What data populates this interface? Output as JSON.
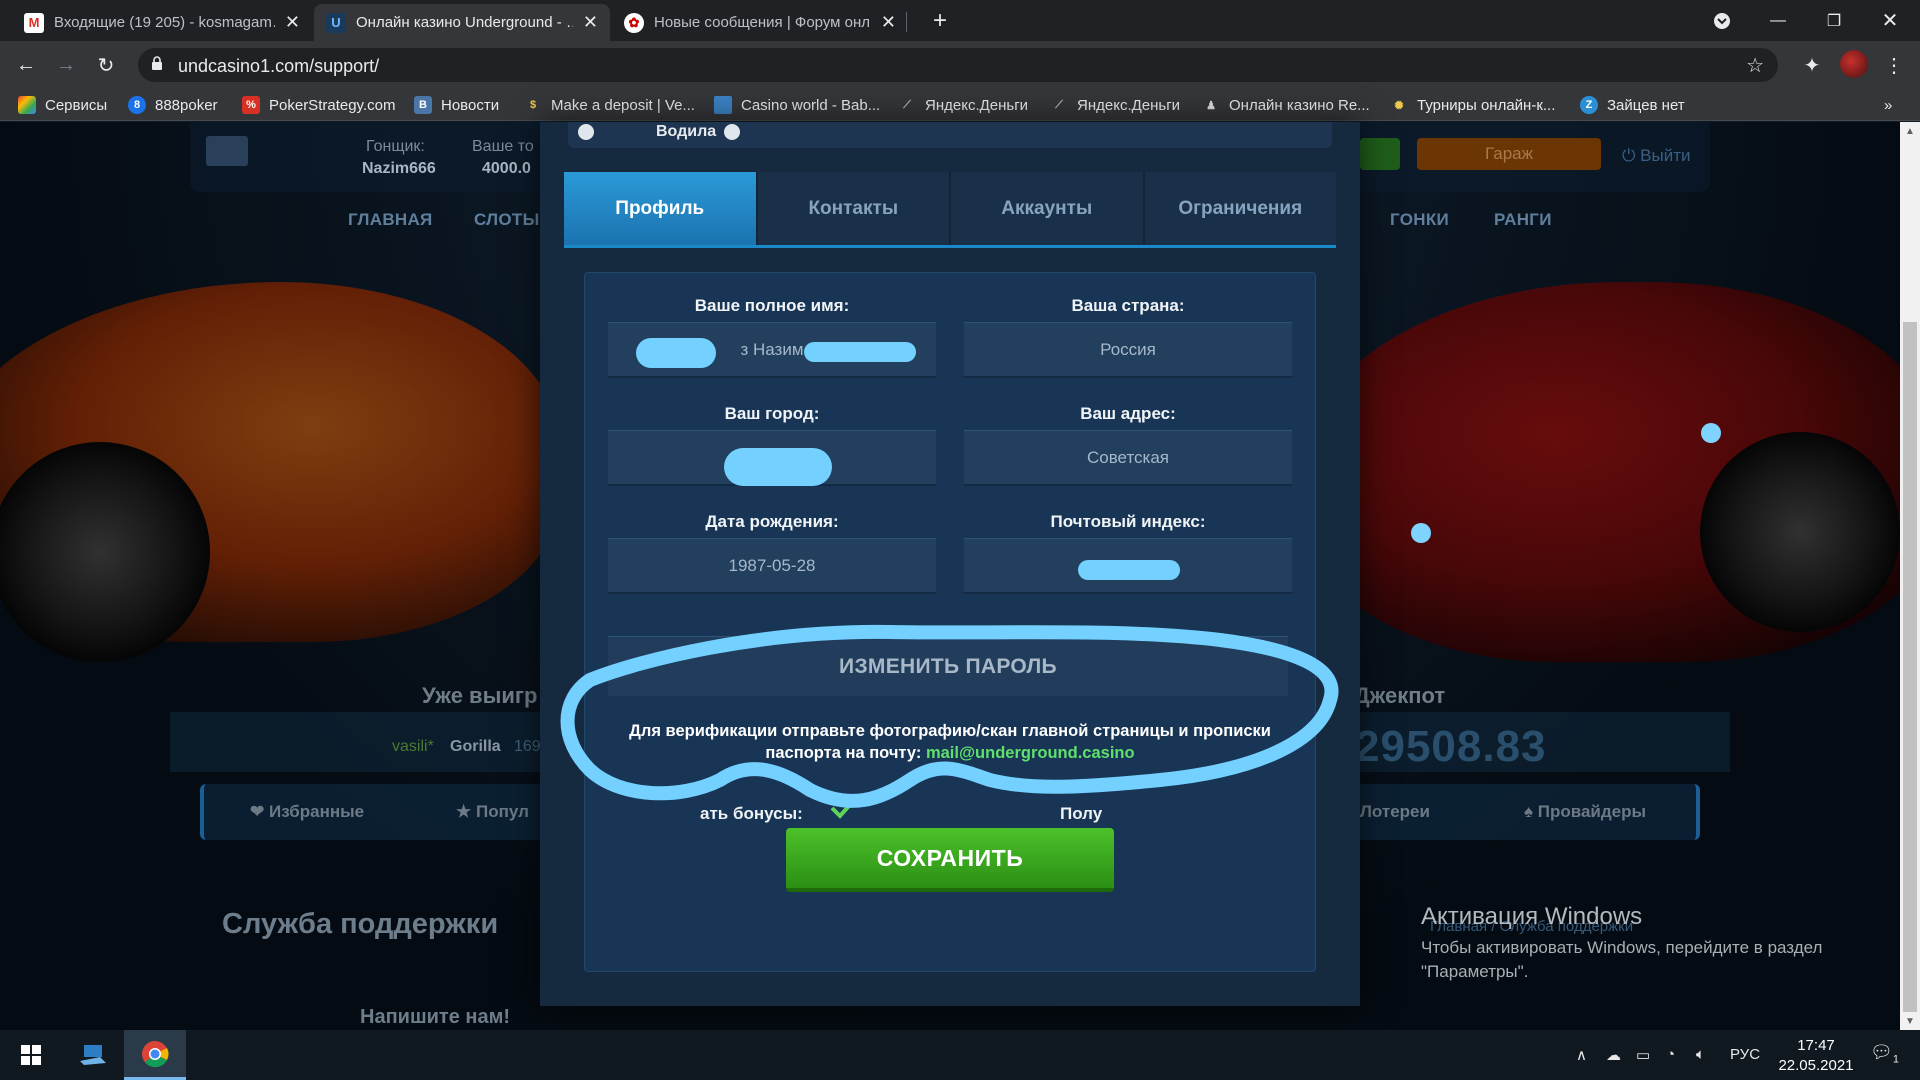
{
  "browser": {
    "tabs": [
      {
        "title": "Входящие (19 205) - kosmagam…",
        "favicon": "gmail-icon"
      },
      {
        "title": "Онлайн казино Underground - …",
        "favicon": "underground-icon"
      },
      {
        "title": "Новые сообщения | Форум онл…",
        "favicon": "forum-icon"
      }
    ],
    "url": "undcasino1.com/support/",
    "bookmarks": [
      "Сервисы",
      "888poker",
      "PokerStrategy.com",
      "Новости",
      "Make a deposit | Ve...",
      "Casino world - Bab...",
      "Яндекс.Деньги",
      "Яндекс.Деньги",
      "Онлайн казино Re...",
      "Турниры онлайн-к...",
      "Зайцев нет"
    ],
    "bookmarks_more": "»"
  },
  "background": {
    "racer_label": "Гонщик:",
    "racer_name": "Nazim666",
    "balance_label": "Ваше то",
    "balance_value": "4000.0",
    "nav": [
      "ГЛАВНАЯ",
      "СЛОТЫ",
      "ГОНКИ",
      "РАНГИ"
    ],
    "garage": "Гараж",
    "exit": "Выйти",
    "already_won": "Уже выигр",
    "jackpot_label": "Джекпот",
    "jackpot_value": "29508.83",
    "winner_name": "vasili*",
    "winner_game": "Gorilla",
    "winner_amount": "169",
    "bar_items": [
      "Избранные",
      "Попул",
      "Лотереи",
      "Провайдеры"
    ],
    "support_title": "Служба поддержки",
    "write_us": "Напишите нам!",
    "breadcrumb": "Главная / Служба поддержки"
  },
  "modal": {
    "driver_label": "Водила",
    "tabs": [
      "Профиль",
      "Контакты",
      "Аккаунты",
      "Ограничения"
    ],
    "active_tab": "Профиль",
    "fields": {
      "full_name_label": "Ваше полное имя:",
      "full_name_value": "з Назим",
      "country_label": "Ваша страна:",
      "country_value": "Россия",
      "city_label": "Ваш город:",
      "city_value": "",
      "address_label": "Ваш адрес:",
      "address_value": "Советская",
      "birth_label": "Дата рождения:",
      "birth_value": "1987-05-28",
      "postal_label": "Почтовый индекс:",
      "postal_value": ""
    },
    "change_password": "ИЗМЕНИТЬ ПАРОЛЬ",
    "verify_text": "Для верификации отправьте фотографию/скан главной страницы и прописки паспорта на почту:",
    "verify_email": "mail@underground.casino",
    "bonus_left": "ать бонусы:",
    "bonus_right": "Полу",
    "save": "СОХРАНИТЬ"
  },
  "watermark": {
    "title": "Активация Windows",
    "text": "Чтобы активировать Windows, перейдите в раздел \"Параметры\"."
  },
  "taskbar": {
    "lang": "РУС",
    "time": "17:47",
    "date": "22.05.2021",
    "notifications": "1"
  },
  "colors": {
    "accent": "#1a89c7",
    "save_green": "#3aa81f",
    "email_green": "#5fe06b",
    "scribble": "#74d0ff"
  }
}
